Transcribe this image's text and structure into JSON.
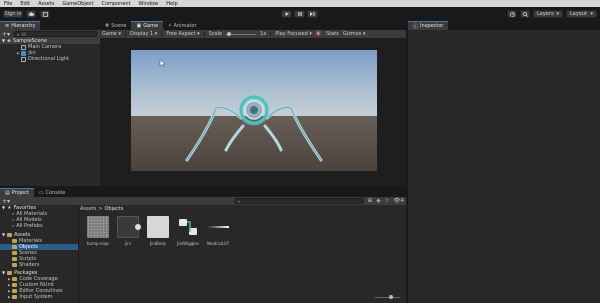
{
  "menu": [
    "File",
    "Edit",
    "Assets",
    "GameObject",
    "Component",
    "Window",
    "Help"
  ],
  "toolbar": {
    "sign_in": "Sign in",
    "layers": "Layers",
    "layout": "Layout"
  },
  "hierarchy": {
    "tab": "Hierarchy",
    "search_placeholder": "All",
    "scene": "SampleScene",
    "items": [
      "Main Camera",
      "jini",
      "Directional Light"
    ]
  },
  "scene_tabs": [
    "Scene",
    "Game",
    "Animator"
  ],
  "game_toolbar": {
    "display_mode": "Game",
    "display": "Display 1",
    "aspect": "Free Aspect",
    "scale_label": "Scale",
    "scale_value": "1x",
    "play_mode": "Play Focused",
    "stats": "Stats",
    "gizmos": "Gizmos"
  },
  "inspector": {
    "tab": "Inspector"
  },
  "project": {
    "tabs": [
      "Project",
      "Console"
    ],
    "favorites": {
      "title": "Favorites",
      "items": [
        "All Materials",
        "All Models",
        "All Prefabs"
      ]
    },
    "assets": {
      "title": "Assets",
      "items": [
        "Materials",
        "Objects",
        "Scenes",
        "Scripts",
        "Shaders"
      ]
    },
    "packages": {
      "title": "Packages",
      "items": [
        "Code Coverage",
        "Custom NUnit",
        "Editor Coroutines",
        "Input System"
      ]
    },
    "breadcrumb": [
      "Assets",
      "Objects"
    ],
    "hidden_count": "4",
    "files": [
      "bump-map...",
      "jini",
      "JiniBody",
      "JiniWiggles",
      "NeutralLUT"
    ]
  },
  "colors": {
    "accent": "#3a79bb",
    "selected_row": "#2c5d87",
    "folder": "#c2a15a"
  }
}
